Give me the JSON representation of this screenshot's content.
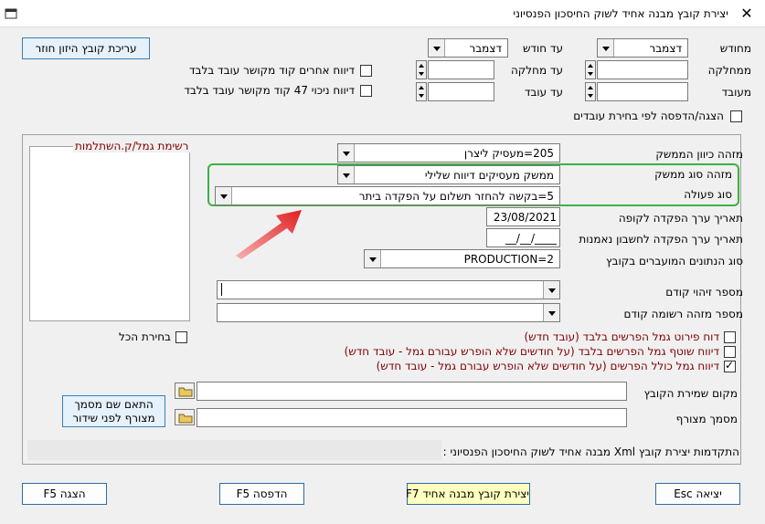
{
  "window": {
    "title": "יצירת קובץ מבנה אחיד לשוק החיסכון הפנסיוני",
    "close_glyph": "✕"
  },
  "top": {
    "from_month_label": "מחודש",
    "from_month_value": "דצמבר",
    "to_month_label": "עד חודש",
    "to_month_value": "דצמבר",
    "from_dept_label": "ממחלקה",
    "to_dept_label": "עד מחלקה",
    "from_emp_label": "מעובד",
    "to_emp_label": "עד עובד",
    "edit_feed_btn": "עריכת קובץ היזון חוזר",
    "other_reports_chk": "דיווח אחרים קוד מקושר עובד בלבד",
    "deduct47_chk": "דיווח ניכוי 47 קוד מקושר עובד בלבד",
    "show_print_chk": "הצגה/הדפסה לפי בחירת עובדים"
  },
  "list": {
    "title": "רשימת גמל/ק.השתלמות",
    "select_all": "בחירת הכל"
  },
  "form": {
    "employer_dir_label": "מזהה כיוון הממשק",
    "employer_dir_value": "205=מעסיק ליצרן",
    "iface_type_label": "מזהה סוג ממשק",
    "iface_type_value": "ממשק מעסיקים דיווח שלילי",
    "action_type_label": "סוג פעולה",
    "action_type_value": "5=בקשה להחזר תשלום על הפקדה ביתר",
    "value_date_label": "תאריך ערך הפקדה לקופה",
    "value_date_value": "23/08/2021",
    "trust_date_label": "תאריך ערך הפקדה לחשבון נאמנות",
    "trust_date_value": "__/__/____",
    "data_type_label": "סוג הנתונים המועברים בקובץ",
    "data_type_value": "PRODUCTION=2",
    "prev_id_label": "מספר זיהוי קודם",
    "prev_record_label": "מספר מזהה רשומה קודם",
    "chk1": "דוח פירוט גמל הפרשים בלבד (עובד חדש)",
    "chk2": "דיווח שוטף גמל הפרשים בלבד (על חודשים שלא הופרש עבורם גמל - עובד חדש)",
    "chk3": "דיווח גמל כולל הפרשים (על חודשים שלא הופרש עבורם גמל - עובד חדש)",
    "save_loc_label": "מקום שמירת הקובץ",
    "attach_label": "מסמך מצורף",
    "match_btn_line1": "התאם שם מסמך",
    "match_btn_line2": "מצורף לפני שידור",
    "progress_label": "התקדמות יצירת קובץ Xml מבנה אחיד לשוק החיסכון הפנסיוני :"
  },
  "buttons": {
    "exit": "יציאה Esc",
    "create": "יצירת קובץ מבנה אחיד F7",
    "print": "הדפסה F5",
    "show": "הצגה F5"
  },
  "colors": {
    "highlight": "#3cb043",
    "arrow": "#e02020",
    "dark_red": "#800000"
  }
}
